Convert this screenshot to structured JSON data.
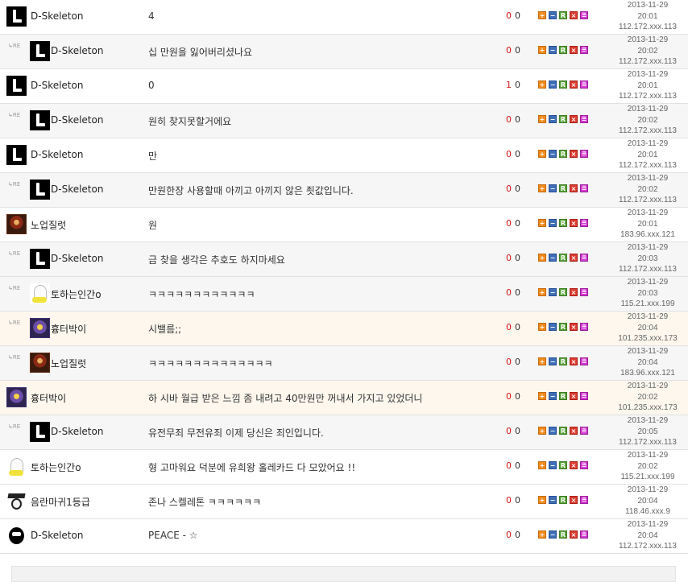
{
  "icons": {
    "reply": "reply-icon",
    "actions": [
      "plus-icon",
      "minus-icon",
      "report-icon",
      "delete-icon",
      "profile-icon"
    ]
  },
  "action_labels": {
    "plus": "+",
    "minus": "−",
    "report": "R",
    "delete": "×",
    "profile": "≞"
  },
  "colors": {
    "upvote": "#d21616",
    "plus": "#f08a1a",
    "minus": "#3f6fb8",
    "report": "#5aa23a",
    "delete": "#dc3b30",
    "profile": "#d23ad0",
    "reply_row_bg": "#f6f6f6",
    "highlight_row_bg": "#fdf7ee"
  },
  "comments": [
    {
      "reply": false,
      "avatar": "l",
      "nick": "D-Skeleton",
      "content": "4",
      "up": "0",
      "down": "0",
      "date": "2013-11-29",
      "time": "20:01",
      "ip": "112.172.xxx.113",
      "highlight": false
    },
    {
      "reply": true,
      "avatar": "l",
      "nick": "D-Skeleton",
      "content": "십 만원을 잃어버리셨나요",
      "up": "0",
      "down": "0",
      "date": "2013-11-29",
      "time": "20:02",
      "ip": "112.172.xxx.113",
      "highlight": false
    },
    {
      "reply": false,
      "avatar": "l",
      "nick": "D-Skeleton",
      "content": "0",
      "up": "1",
      "down": "0",
      "date": "2013-11-29",
      "time": "20:01",
      "ip": "112.172.xxx.113",
      "highlight": false
    },
    {
      "reply": true,
      "avatar": "l",
      "nick": "D-Skeleton",
      "content": "원히 찾지못할거에요",
      "up": "0",
      "down": "0",
      "date": "2013-11-29",
      "time": "20:02",
      "ip": "112.172.xxx.113",
      "highlight": false
    },
    {
      "reply": false,
      "avatar": "l",
      "nick": "D-Skeleton",
      "content": "만",
      "up": "0",
      "down": "0",
      "date": "2013-11-29",
      "time": "20:01",
      "ip": "112.172.xxx.113",
      "highlight": false
    },
    {
      "reply": true,
      "avatar": "l",
      "nick": "D-Skeleton",
      "content": "만원한장 사용할때 아끼고 아끼지 않은 죗값입니다.",
      "up": "0",
      "down": "0",
      "date": "2013-11-29",
      "time": "20:02",
      "ip": "112.172.xxx.113",
      "highlight": false
    },
    {
      "reply": false,
      "avatar": "warrior",
      "nick": "노업질럿",
      "content": "원",
      "up": "0",
      "down": "0",
      "date": "2013-11-29",
      "time": "20:01",
      "ip": "183.96.xxx.121",
      "highlight": false
    },
    {
      "reply": true,
      "avatar": "l",
      "nick": "D-Skeleton",
      "content": "금 찾을 생각은 추호도 하지마세요",
      "up": "0",
      "down": "0",
      "date": "2013-11-29",
      "time": "20:03",
      "ip": "112.172.xxx.113",
      "highlight": false
    },
    {
      "reply": true,
      "avatar": "ghost",
      "nick": "토하는인간o",
      "content": "ㅋㅋㅋㅋㅋㅋㅋㅋㅋㅋㅋㅋ",
      "up": "0",
      "down": "0",
      "date": "2013-11-29",
      "time": "20:03",
      "ip": "115.21.xxx.199",
      "highlight": false
    },
    {
      "reply": true,
      "avatar": "warrior2",
      "nick": "흉터박이",
      "content": "시밸름;;",
      "up": "0",
      "down": "0",
      "date": "2013-11-29",
      "time": "20:04",
      "ip": "101.235.xxx.173",
      "highlight": true
    },
    {
      "reply": true,
      "avatar": "warrior",
      "nick": "노업질럿",
      "content": "ㅋㅋㅋㅋㅋㅋㅋㅋㅋㅋㅋㅋㅋㅋ",
      "up": "0",
      "down": "0",
      "date": "2013-11-29",
      "time": "20:04",
      "ip": "183.96.xxx.121",
      "highlight": false
    },
    {
      "reply": false,
      "avatar": "warrior2",
      "nick": "흉터박이",
      "content": "하 시바 월급 받은 느낌 좀 내려고 40만원만 꺼내서 가지고 있었더니",
      "up": "0",
      "down": "0",
      "date": "2013-11-29",
      "time": "20:02",
      "ip": "101.235.xxx.173",
      "highlight": true
    },
    {
      "reply": true,
      "avatar": "l",
      "nick": "D-Skeleton",
      "content": "유전무죄 무전유죄 이제 당신은 죄인입니다.",
      "up": "0",
      "down": "0",
      "date": "2013-11-29",
      "time": "20:05",
      "ip": "112.172.xxx.113",
      "highlight": false
    },
    {
      "reply": false,
      "avatar": "ghost",
      "nick": "토하는인간o",
      "content": "형 고마워요 덕분에 유희왕 홀레카드 다 모았어요 !!",
      "up": "0",
      "down": "0",
      "date": "2013-11-29",
      "time": "20:02",
      "ip": "115.21.xxx.199",
      "highlight": false
    },
    {
      "reply": false,
      "avatar": "grad",
      "nick": "음란마귀1등급",
      "content": "존나 스켈레톤 ㅋㅋㅋㅋㅋㅋ",
      "up": "0",
      "down": "0",
      "date": "2013-11-29",
      "time": "20:04",
      "ip": "118.46.xxx.9",
      "highlight": false
    },
    {
      "reply": false,
      "avatar": "skull",
      "nick": "D-Skeleton",
      "content": "PEACE - ☆",
      "up": "0",
      "down": "0",
      "date": "2013-11-29",
      "time": "20:04",
      "ip": "112.172.xxx.113",
      "highlight": false
    }
  ]
}
